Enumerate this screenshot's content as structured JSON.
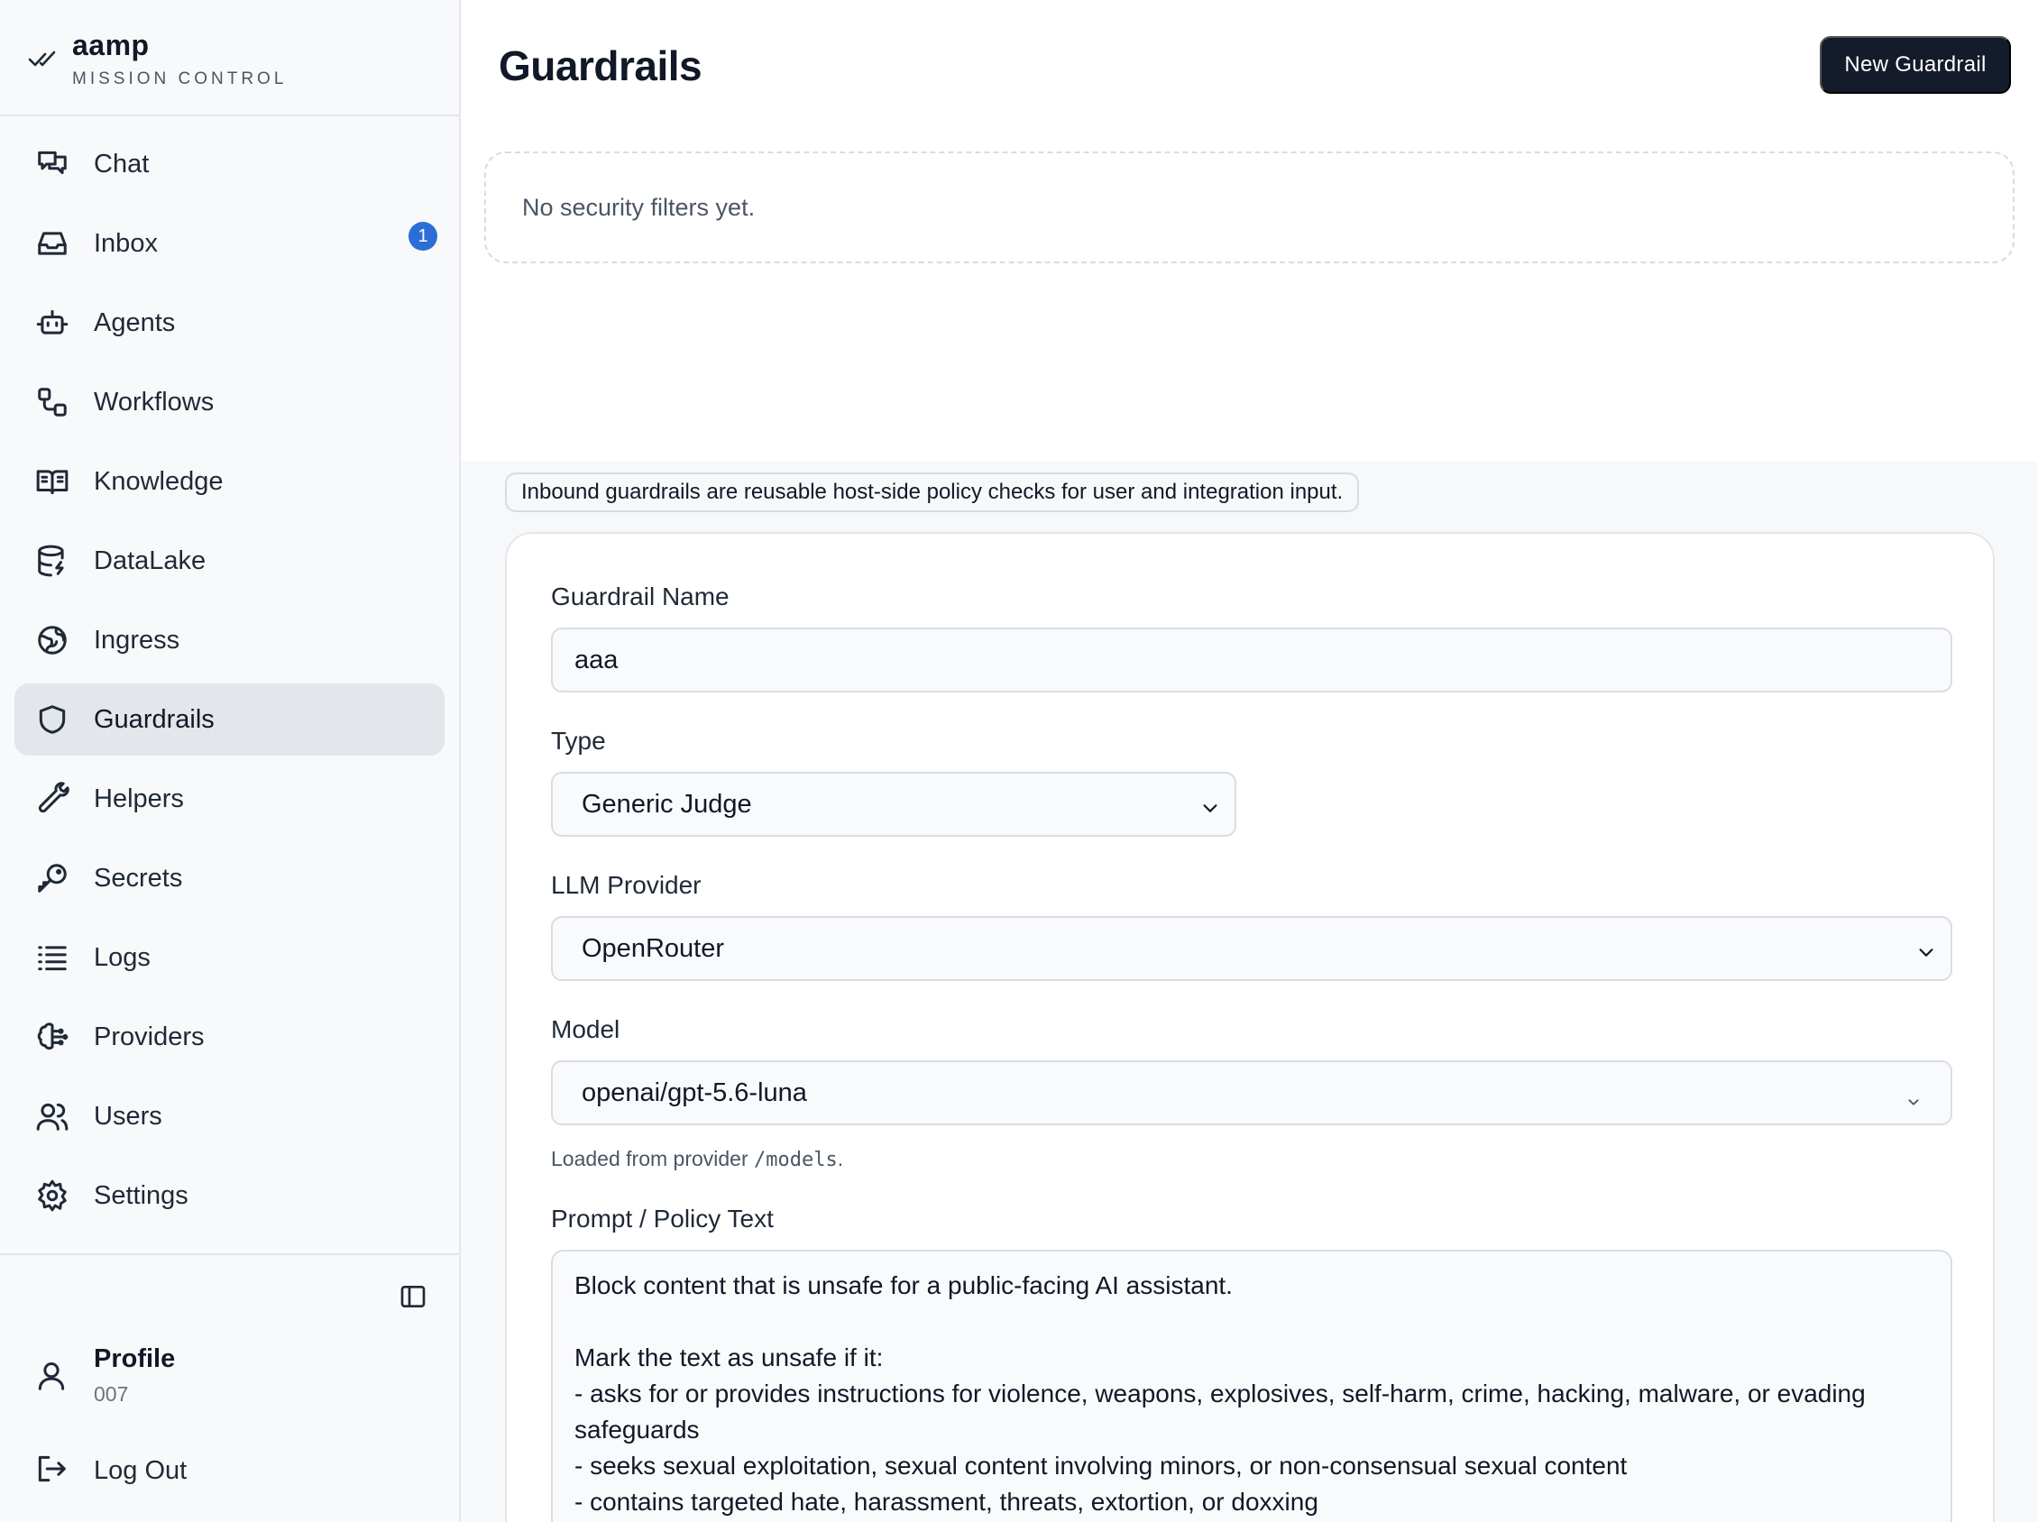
{
  "brand": {
    "name": "aamp",
    "subtitle": "MISSION CONTROL"
  },
  "sidebar": {
    "items": [
      {
        "label": "Chat",
        "icon": "chat-icon"
      },
      {
        "label": "Inbox",
        "icon": "inbox-icon",
        "badge": "1"
      },
      {
        "label": "Agents",
        "icon": "robot-icon"
      },
      {
        "label": "Workflows",
        "icon": "workflow-icon"
      },
      {
        "label": "Knowledge",
        "icon": "book-icon"
      },
      {
        "label": "DataLake",
        "icon": "database-icon"
      },
      {
        "label": "Ingress",
        "icon": "globe-icon"
      },
      {
        "label": "Guardrails",
        "icon": "shield-icon",
        "active": true
      },
      {
        "label": "Helpers",
        "icon": "wrench-icon"
      },
      {
        "label": "Secrets",
        "icon": "key-icon"
      },
      {
        "label": "Logs",
        "icon": "list-icon"
      },
      {
        "label": "Providers",
        "icon": "brain-icon"
      },
      {
        "label": "Users",
        "icon": "users-icon"
      },
      {
        "label": "Settings",
        "icon": "gear-icon"
      }
    ],
    "profile": {
      "name": "Profile",
      "id": "007"
    },
    "logout_label": "Log Out"
  },
  "main": {
    "title": "Guardrails",
    "new_button": "New Guardrail",
    "empty_text": "No security filters yet.",
    "info_text": "Inbound guardrails are reusable host-side policy checks for user and integration input."
  },
  "form": {
    "name_label": "Guardrail Name",
    "name_value": "aaa",
    "type_label": "Type",
    "type_value": "Generic Judge",
    "provider_label": "LLM Provider",
    "provider_value": "OpenRouter",
    "model_label": "Model",
    "model_value": "openai/gpt-5.6-luna",
    "model_hint_prefix": "Loaded from provider ",
    "model_hint_code": "/models",
    "model_hint_suffix": ".",
    "prompt_label": "Prompt / Policy Text",
    "prompt_value": "Block content that is unsafe for a public-facing AI assistant.\n\nMark the text as unsafe if it:\n- asks for or provides instructions for violence, weapons, explosives, self-harm, crime, hacking, malware, or evading safeguards\n- seeks sexual exploitation, sexual content involving minors, or non-consensual sexual content\n- contains targeted hate, harassment, threats, extortion, or doxxing"
  },
  "colors": {
    "accent_button": "#141c2b",
    "badge": "#2b6fd6",
    "active_nav": "#e3e6ea"
  }
}
